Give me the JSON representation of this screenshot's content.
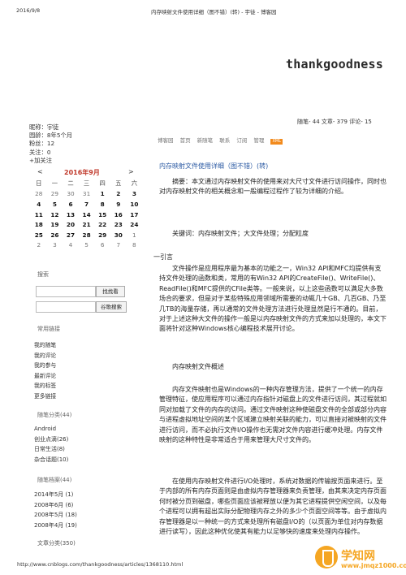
{
  "header": {
    "date": "2016/9/8",
    "title": "内存映射文件使用详细（图不错）(转) - 宇徒 - 博客园"
  },
  "blog": {
    "title": "thankgoodness",
    "stats": "随笔- 44  文章- 379  评论- 15"
  },
  "profile": {
    "nickname": "昵称：宇徒",
    "age": "园龄：8年5个月",
    "fans": "粉丝：12",
    "follow": "关注：0",
    "add_follow": "+加关注"
  },
  "calendar": {
    "prev": "<",
    "month": "2016年9月",
    "next": ">",
    "weekdays": [
      "日",
      "一",
      "二",
      "三",
      "四",
      "五",
      "六"
    ],
    "weeks": [
      [
        "28",
        "29",
        "30",
        "31",
        "1",
        "2",
        "3"
      ],
      [
        "4",
        "5",
        "6",
        "7",
        "8",
        "9",
        "10"
      ],
      [
        "11",
        "12",
        "13",
        "14",
        "15",
        "16",
        "17"
      ],
      [
        "18",
        "19",
        "20",
        "21",
        "22",
        "23",
        "24"
      ],
      [
        "25",
        "26",
        "27",
        "28",
        "29",
        "30",
        "1"
      ],
      [
        "2",
        "3",
        "4",
        "5",
        "6",
        "7",
        "8"
      ]
    ]
  },
  "search": {
    "title": "搜索",
    "btn1": "找找看",
    "btn2": "谷歌搜索"
  },
  "links": {
    "title": "常用链接",
    "items": [
      "我的随笔",
      "我的评论",
      "我的参与",
      "最新评论",
      "我的标签",
      "更多链接"
    ]
  },
  "tags": {
    "title": "随笔分类(44)",
    "items": [
      "Android",
      "创业点滴(26)",
      "日常生活(8)",
      "杂合话题(10)"
    ]
  },
  "archive": {
    "title": "随笔档案(44)",
    "items": [
      "2014年5月 (1)",
      "2008年6月 (6)",
      "2008年5月 (18)",
      "2008年4月 (19)"
    ],
    "more": "文章分类(350)"
  },
  "nav": {
    "items": [
      "博客园",
      "首页",
      "新随笔",
      "联系",
      "订阅",
      "管理"
    ],
    "xml": "XML"
  },
  "post": {
    "title": "内存映射文件使用详细（图不错）(转)",
    "abstract": "摘要：本文通过内存映射文件的使用来对大尺寸文件进行访问操作，同时也对内存映射文件的相关概念和一般编程过程作了较为详细的介绍。",
    "keywords": "关键词：内存映射文件；大文件处理；分配粒度",
    "intro": "一引言",
    "para1": "文件操作是应用程序最为基本的功能之一，Win32 API和MFC均提供有支持文件处理的函数和类，常用的有Win32 API的CreateFile()、WriteFile()、ReadFile()和MFC提供的CFile类等。一般来说，以上这些函数可以满足大多数场合的要求，但是对于某些特殊应用领域所需要的动辄几十GB、几百GB、乃至几TB的海量存储，再以通常的文件处理方法进行处理显然是行不通的。目前，对于上述这种大文件的操作一般是以内存映射文件的方式来加以处理的，本文下面将针对这种Windows核心编程技术展开讨论。",
    "section": "内存映射文件概述",
    "para2": "内存文件映射也是Windows的一种内存管理方法，提供了一个统一的内存管理特征，使应用程序可以通过内存指针对磁盘上的文件进行访问，其过程就如同对加载了文件的内存的访问。通过文件映射这种使磁盘文件的全部或部分内容与进程虚拟地址空间的某个区域建立映射关联的能力，可以直接对被映射的文件进行访问，而不必执行文件I/O操作也无需对文件内容进行缓冲处理。内存文件映射的这种特性是非常适合于用来管理大尺寸文件的。",
    "para3": "在使用内存映射文件进行I/O处理时，系统对数据的传输按页面来进行。至于内部的所有内存页面则是由虚拟内存管理器来负责管理，由其来决定内存页面何时被分页到磁盘，哪些页面应该被释放以便为其它进程提供空闲空间，以及每个进程可以拥有超出实际分配物理内存之外的多少个页面空间等等。由于虚拟内存管理器是以一种统一的方式来处理所有磁盘I/O的（以页面为单位对内存数据进行读写），因此这种优化使其有能力以足够快的速度来处理内存操作。"
  },
  "footer": {
    "url": "http://www.cnblogs.com/thankgoodness/articles/1368110.html"
  },
  "watermark": {
    "brand": "学知网",
    "url": "www.jmqz1000.com",
    "color": "#f5a623"
  }
}
